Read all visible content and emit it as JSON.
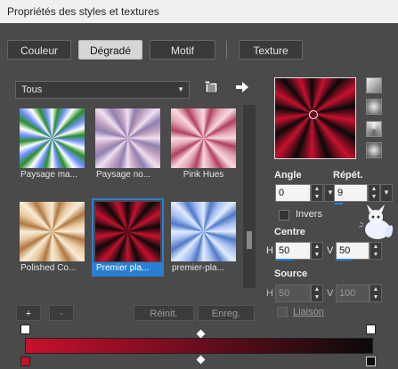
{
  "window": {
    "title": "Propriétés des styles et textures"
  },
  "tabs": [
    {
      "label": "Couleur",
      "active": false
    },
    {
      "label": "Dégradé",
      "active": true
    },
    {
      "label": "Motif",
      "active": false
    },
    {
      "label": "Texture",
      "active": false
    }
  ],
  "category": {
    "selected": "Tous"
  },
  "gradients": [
    {
      "label": "Paysage ma..."
    },
    {
      "label": "Paysage no..."
    },
    {
      "label": "Pink Hues"
    },
    {
      "label": "Polished Co..."
    },
    {
      "label": "Premier pla...",
      "selected": true
    },
    {
      "label": "premier-pla..."
    }
  ],
  "buttons": {
    "add": "+",
    "remove": "-",
    "reset": "Réinit.",
    "save": "Enreg."
  },
  "settings": {
    "angle_label": "Angle",
    "angle_value": "0",
    "repeat_label": "Répét.",
    "repeat_value": "9",
    "invert_label": "Invers",
    "centre_label": "Centre",
    "centre_h_label": "H",
    "centre_h_value": "50",
    "centre_v_label": "V",
    "centre_v_value": "50",
    "source_label": "Source",
    "source_h_label": "H",
    "source_h_value": "50",
    "source_v_label": "V",
    "source_v_value": "100",
    "link_label": "Liaison"
  },
  "colors": {
    "accent": "#2a7fd4",
    "gradient_red": "#c8102e",
    "gradient_dark": "#0a0a0a"
  }
}
